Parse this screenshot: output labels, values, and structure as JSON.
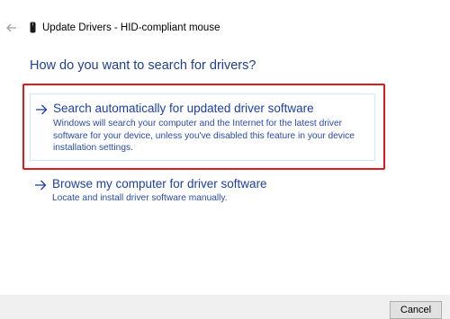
{
  "window": {
    "title": "Update Drivers - HID-compliant mouse",
    "back_icon": "back-arrow-icon",
    "device_icon": "mouse-icon"
  },
  "main": {
    "heading": "How do you want to search for drivers?",
    "options": [
      {
        "title": "Search automatically for updated driver software",
        "description": "Windows will search your computer and the Internet for the latest driver software for your device, unless you've disabled this feature in your device installation settings.",
        "icon": "right-arrow-icon",
        "highlighted": true
      },
      {
        "title": "Browse my computer for driver software",
        "description": "Locate and install driver software manually.",
        "icon": "right-arrow-icon",
        "highlighted": false
      }
    ]
  },
  "footer": {
    "cancel_label": "Cancel"
  },
  "colors": {
    "heading": "#1f3f91",
    "link": "#1c3fa6",
    "highlight_border": "#e0191f",
    "footer_bg": "#f0f0f0"
  }
}
